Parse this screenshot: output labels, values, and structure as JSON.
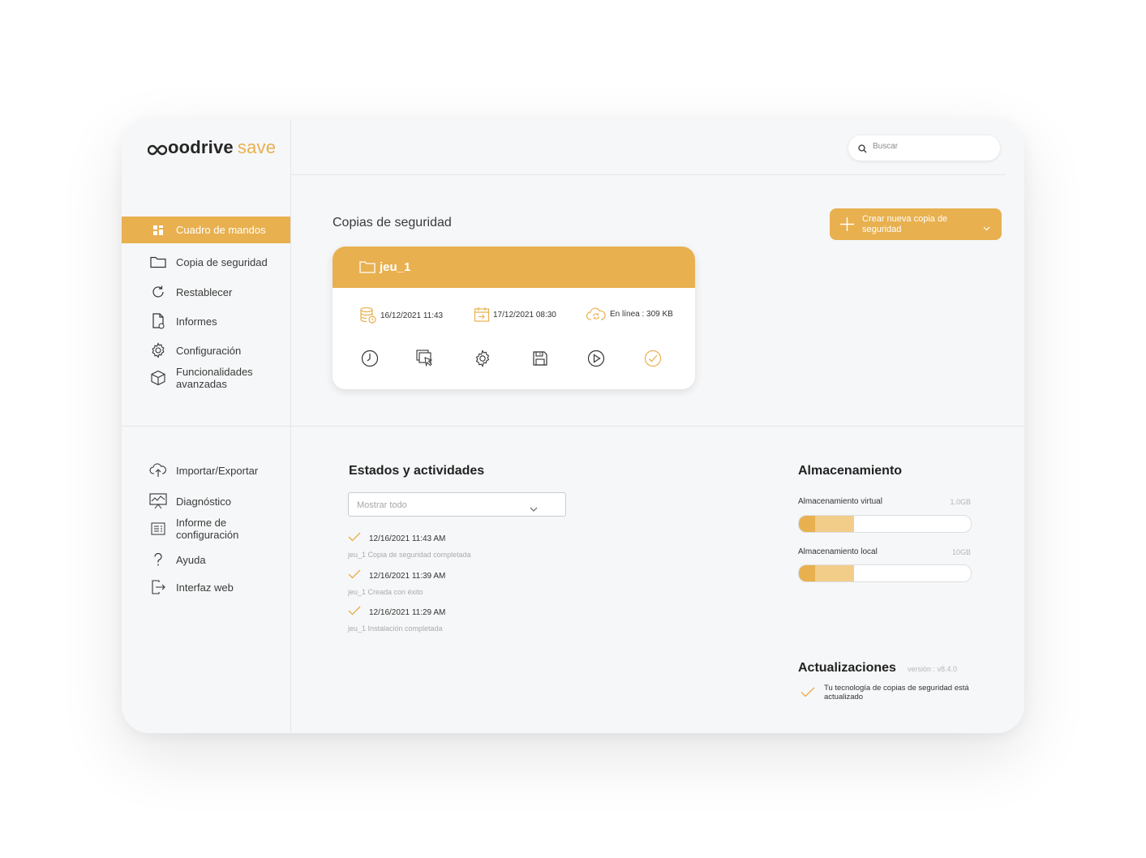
{
  "app": {
    "brand": "oodrive",
    "product": "save",
    "accent_color": "#e8b04f"
  },
  "sidebar": {
    "primary": [
      {
        "label": "Cuadro de mandos",
        "icon": "dashboard-icon",
        "active": true
      },
      {
        "label": "Copia de seguridad",
        "icon": "folder-icon"
      },
      {
        "label": "Restablecer",
        "icon": "refresh-icon"
      },
      {
        "label": "Informes",
        "icon": "report-icon"
      },
      {
        "label": "Configuración",
        "icon": "gear-icon"
      },
      {
        "label": "Funcionalidades avanzadas",
        "icon": "cube-icon"
      }
    ],
    "secondary": [
      {
        "label": "Importar/Exportar",
        "icon": "cloud-upload-icon"
      },
      {
        "label": "Diagnóstico",
        "icon": "monitor-chart-icon"
      },
      {
        "label": "Informe de configuración",
        "icon": "config-list-icon"
      },
      {
        "label": "Ayuda",
        "icon": "help-icon"
      },
      {
        "label": "Interfaz web",
        "icon": "logout-icon"
      }
    ]
  },
  "search": {
    "placeholder": "Buscar"
  },
  "backups": {
    "title": "Copias de seguridad",
    "create_button": "Crear nueva copia de seguridad",
    "card": {
      "name": "jeu_1",
      "last_backup": "16/12/2021 11:43",
      "next_backup": "17/12/2021 08:30",
      "online_size": "En línea : 309 KB",
      "actions": [
        "clock-icon",
        "restore-icon",
        "gear-icon",
        "save-icon",
        "play-icon",
        "check-circle-icon"
      ]
    }
  },
  "activities": {
    "title": "Estados y actividades",
    "filter": "Mostrar todo",
    "items": [
      {
        "time": "12/16/2021 11:43 AM",
        "desc": "jeu_1 Copia de seguridad completada"
      },
      {
        "time": "12/16/2021 11:39 AM",
        "desc": "jeu_1 Creada con éxito"
      },
      {
        "time": "12/16/2021 11:29 AM",
        "desc": "jeu_1 Instalación completada"
      }
    ]
  },
  "storage": {
    "title": "Almacenamiento",
    "virtual": {
      "label": "Almacenamiento virtual",
      "capacity": "1.0GB",
      "used_fraction": 0.32
    },
    "local": {
      "label": "Almacenamiento local",
      "capacity": "10GB",
      "used_fraction": 0.32
    }
  },
  "updates": {
    "title": "Actualizaciones",
    "version": "versión : v8.4.0",
    "status": "Tu tecnología de copias de seguridad está actualizado"
  }
}
